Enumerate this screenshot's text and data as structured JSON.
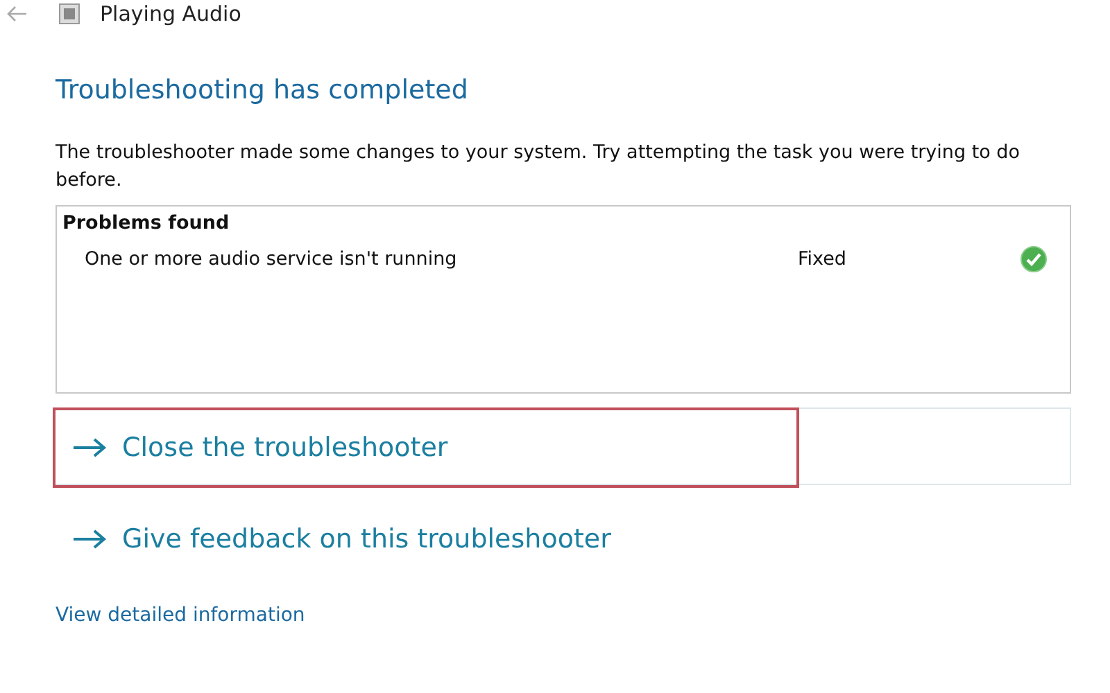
{
  "window": {
    "title": "Playing Audio"
  },
  "heading": "Troubleshooting has completed",
  "description": "The troubleshooter made some changes to your system. Try attempting the task you were trying to do before.",
  "problems": {
    "title": "Problems found",
    "rows": [
      {
        "problem": "One or more audio service isn't running",
        "status": "Fixed",
        "fixed": true
      }
    ]
  },
  "commands": [
    {
      "label": "Close the troubleshooter",
      "selected": true,
      "highlighted": true
    },
    {
      "label": "Give feedback on this troubleshooter",
      "selected": false,
      "highlighted": false
    }
  ],
  "details_link": "View detailed information"
}
